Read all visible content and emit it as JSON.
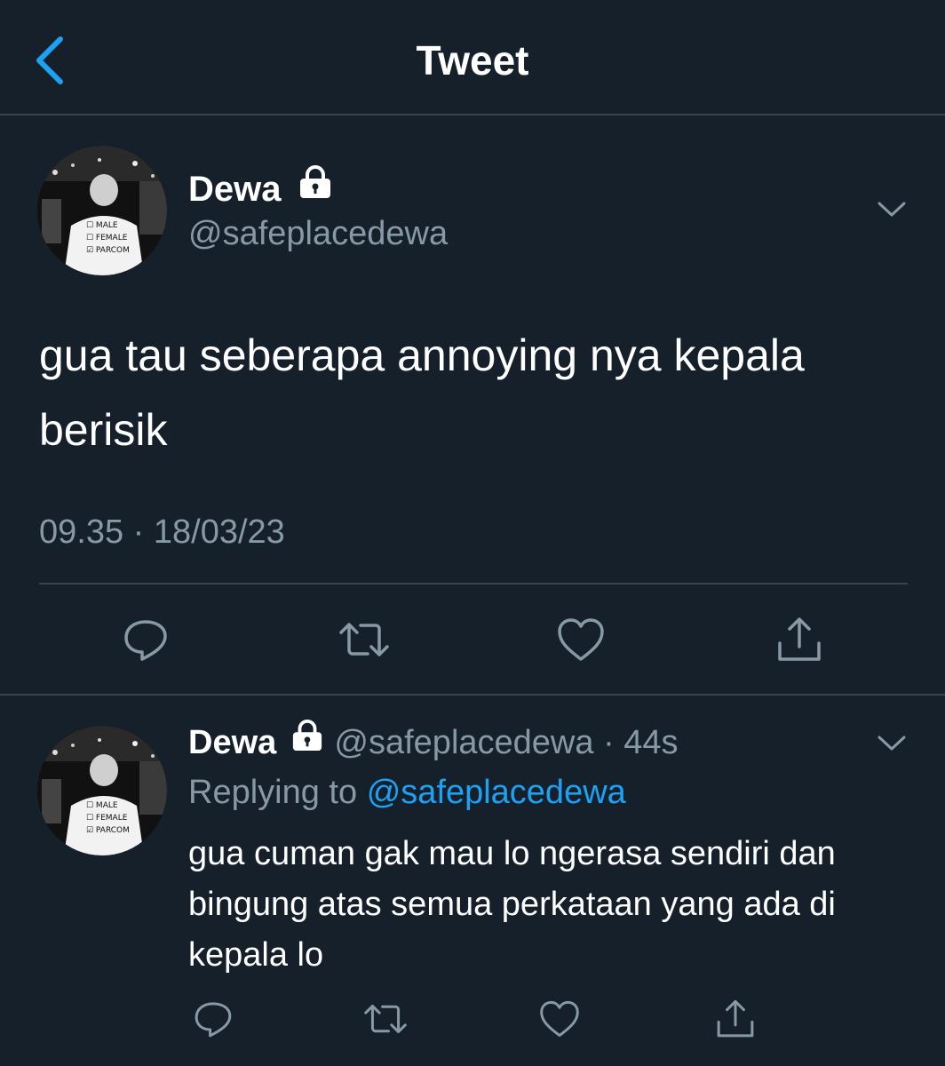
{
  "header": {
    "title": "Tweet",
    "back_icon": "chevron-left-icon"
  },
  "colors": {
    "background": "#15202b",
    "accent": "#1da1f2",
    "muted": "#8899a6",
    "divider": "#38444d"
  },
  "main_tweet": {
    "name": "Dewa",
    "handle": "@safeplacedewa",
    "protected_icon": "lock-icon",
    "text": "gua tau seberapa annoying nya kepala berisik",
    "timestamp": "09.35 · 18/03/23",
    "actions": [
      "reply-icon",
      "retweet-icon",
      "like-icon",
      "share-icon"
    ]
  },
  "reply": {
    "name": "Dewa",
    "handle": "@safeplacedewa",
    "time": "· 44s",
    "replying_prefix": "Replying to",
    "replying_to": "@safeplacedewa",
    "text": "gua cuman gak mau lo ngerasa sendiri dan bingung atas semua perkataan yang ada di kepala lo",
    "actions": [
      "reply-icon",
      "retweet-icon",
      "like-icon",
      "share-icon"
    ]
  }
}
